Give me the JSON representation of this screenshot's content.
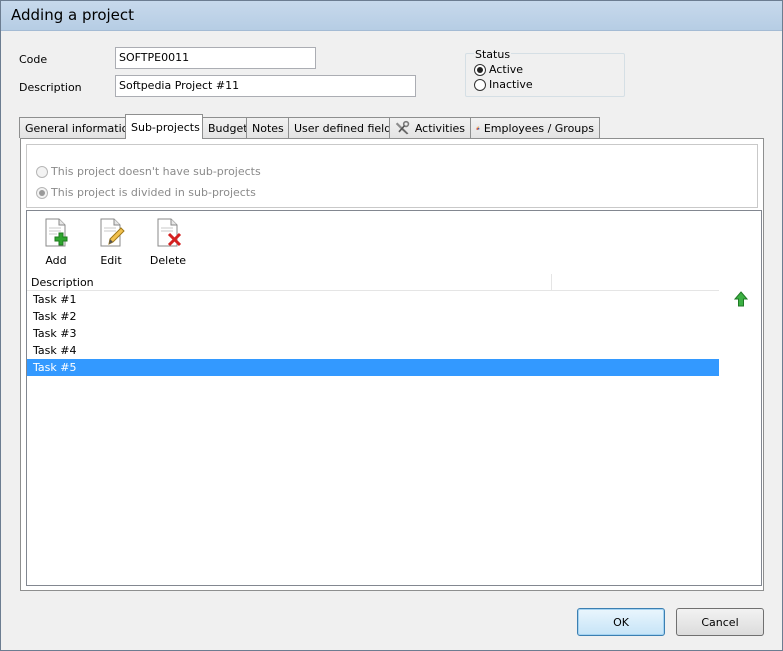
{
  "window": {
    "title": "Adding a project"
  },
  "form": {
    "code_label": "Code",
    "code_value": "SOFTPE0011",
    "description_label": "Description",
    "description_value": "Softpedia Project #11"
  },
  "status": {
    "legend": "Status",
    "options": [
      {
        "label": "Active",
        "checked": true
      },
      {
        "label": "Inactive",
        "checked": false
      }
    ]
  },
  "tabs": [
    {
      "label": "General information",
      "active": false
    },
    {
      "label": "Sub-projects",
      "active": true
    },
    {
      "label": "Budget",
      "active": false
    },
    {
      "label": "Notes",
      "active": false
    },
    {
      "label": "User defined fields",
      "active": false
    },
    {
      "label": "Activities",
      "active": false,
      "icon": "tools-icon"
    },
    {
      "label": "Employees / Groups",
      "active": false,
      "icon": "people-icon"
    }
  ],
  "subprojects": {
    "option_none": "This project doesn't have sub-projects",
    "option_divided": "This project is divided in sub-projects",
    "selected": "divided"
  },
  "toolbar": {
    "add_label": "Add",
    "edit_label": "Edit",
    "delete_label": "Delete"
  },
  "grid": {
    "columns": [
      "Description",
      ""
    ],
    "rows": [
      "Task #1",
      "Task #2",
      "Task #3",
      "Task #4",
      "Task #5"
    ],
    "selected_row": 4
  },
  "buttons": {
    "ok_label": "OK",
    "cancel_label": "Cancel"
  },
  "colors": {
    "selection": "#3399ff",
    "titlebar": "#c7d9ec",
    "add_green": "#2ea52e",
    "delete_red": "#d42020"
  }
}
